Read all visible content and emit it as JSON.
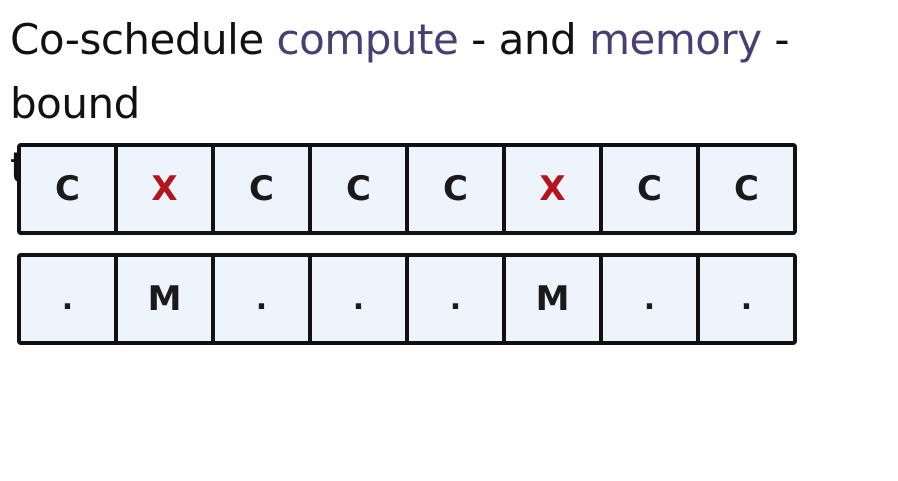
{
  "title": {
    "part1": "Co-schedule ",
    "compute": "compute",
    "part2": " - and ",
    "memory": "memory",
    "part3": " - bound",
    "line2": "threads"
  },
  "rows": {
    "compute": [
      "C",
      "X",
      "C",
      "C",
      "C",
      "X",
      "C",
      "C"
    ],
    "memory": [
      ".",
      "M",
      ".",
      ".",
      ".",
      "M",
      ".",
      "."
    ]
  },
  "colors": {
    "highlight": "#4a3f73",
    "x_mark": "#b5141e"
  }
}
